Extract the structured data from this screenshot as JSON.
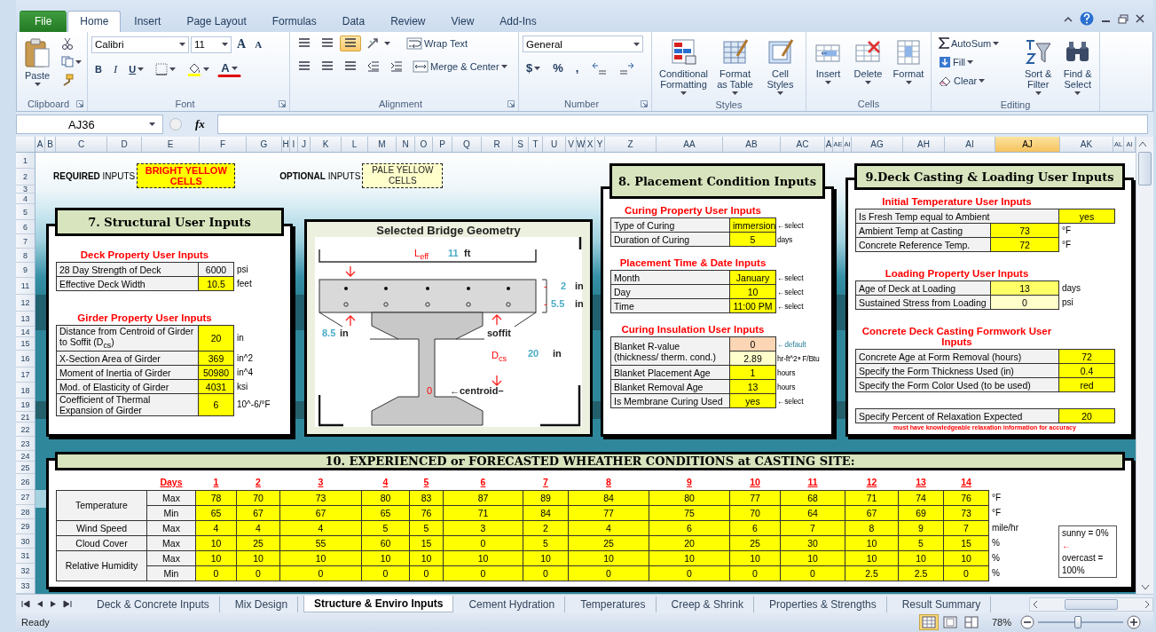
{
  "ribbon": {
    "tabs": [
      {
        "label": "File",
        "kind": "file",
        "selected": false
      },
      {
        "label": "Home",
        "kind": "tab",
        "selected": true
      },
      {
        "label": "Insert",
        "kind": "tab",
        "selected": false
      },
      {
        "label": "Page Layout",
        "kind": "tab",
        "selected": false
      },
      {
        "label": "Formulas",
        "kind": "tab",
        "selected": false
      },
      {
        "label": "Data",
        "kind": "tab",
        "selected": false
      },
      {
        "label": "Review",
        "kind": "tab",
        "selected": false
      },
      {
        "label": "View",
        "kind": "tab",
        "selected": false
      },
      {
        "label": "Add-Ins",
        "kind": "tab",
        "selected": false
      }
    ],
    "clipboard": {
      "label": "Clipboard",
      "paste": "Paste"
    },
    "font": {
      "label": "Font",
      "name": "Calibri",
      "size": "11",
      "grow": "A",
      "shrink": "A",
      "bold": "B",
      "italic": "I",
      "underline": "U",
      "color_letter": "A"
    },
    "alignment": {
      "label": "Alignment",
      "vertical": [
        {
          "selected": false
        },
        {
          "selected": false
        },
        {
          "selected": true
        }
      ],
      "wrap": "Wrap Text",
      "merge": "Merge & Center"
    },
    "number": {
      "label": "Number",
      "format": "General",
      "currency": "$",
      "percent": "%",
      "comma": ","
    },
    "styles": {
      "label": "Styles",
      "buttons": [
        "Conditional Formatting",
        "Format as Table",
        "Cell Styles"
      ]
    },
    "cells": {
      "label": "Cells",
      "buttons": [
        "Insert",
        "Delete",
        "Format"
      ]
    },
    "editing": {
      "label": "Editing",
      "small": [
        "AutoSum",
        "Fill",
        "Clear"
      ],
      "big": [
        "Sort & Filter",
        "Find & Select"
      ]
    }
  },
  "formula_bar": {
    "name_box": "AJ36",
    "function_label": "fx"
  },
  "columns": [
    {
      "label": "A",
      "selected": false
    },
    {
      "label": "B",
      "selected": false
    },
    {
      "label": "C",
      "selected": false
    },
    {
      "label": "D",
      "selected": false
    },
    {
      "label": "E",
      "selected": false
    },
    {
      "label": "F",
      "selected": false
    },
    {
      "label": "G",
      "selected": false
    },
    {
      "label": "H",
      "selected": false
    },
    {
      "label": "I",
      "selected": false
    },
    {
      "label": "J",
      "selected": false
    },
    {
      "label": "K",
      "selected": false
    },
    {
      "label": "L",
      "selected": false
    },
    {
      "label": "M",
      "selected": false
    },
    {
      "label": "N",
      "selected": false
    },
    {
      "label": "O",
      "selected": false
    },
    {
      "label": "P",
      "selected": false
    },
    {
      "label": "Q",
      "selected": false
    },
    {
      "label": "R",
      "selected": false
    },
    {
      "label": "S",
      "selected": false
    },
    {
      "label": "T",
      "selected": false
    },
    {
      "label": "U",
      "selected": false
    },
    {
      "label": "V",
      "selected": false
    },
    {
      "label": "W",
      "selected": false
    },
    {
      "label": "X",
      "selected": false
    },
    {
      "label": "Y",
      "selected": false
    },
    {
      "label": "Z",
      "selected": false
    },
    {
      "label": "AA",
      "selected": false
    },
    {
      "label": "AB",
      "selected": false
    },
    {
      "label": "AC",
      "selected": false
    },
    {
      "label": "A",
      "selected": false
    },
    {
      "label": "AE",
      "selected": false
    },
    {
      "label": "AI",
      "selected": false
    },
    {
      "label": "AG",
      "selected": false
    },
    {
      "label": "AH",
      "selected": false
    },
    {
      "label": "AI",
      "selected": false
    },
    {
      "label": "AJ",
      "selected": true
    },
    {
      "label": "AK",
      "selected": false
    },
    {
      "label": "AL",
      "selected": false
    },
    {
      "label": "AI",
      "selected": false
    }
  ],
  "rows": [
    "1",
    "2",
    "3",
    "4",
    "5",
    "6",
    "7",
    "8",
    "9",
    "11",
    "12",
    "13",
    "14",
    "15",
    "16",
    "17",
    "18",
    "19",
    "21",
    "22",
    "23",
    "24",
    "25",
    "26",
    "27",
    "28",
    "29",
    "30",
    "31",
    "32",
    "33"
  ],
  "legend": {
    "required_label": "**REQUIRED** INPUTS",
    "required_box": "BRIGHT YELLOW CELLS",
    "optional_label": "**OPTIONAL** INPUTS",
    "optional_box": "PALE YELLOW CELLS"
  },
  "structural": {
    "title": "7. Structural User Inputs",
    "sections": [
      {
        "heading": "Deck Property User Inputs",
        "rows": [
          {
            "label": "28 Day Strength of Deck",
            "value": "6000",
            "kind": "calculated",
            "unit": "psi"
          },
          {
            "label": "Effective Deck Width",
            "value": "10.5",
            "kind": "required",
            "unit": "feet"
          }
        ]
      },
      {
        "heading": "Girder Property User Inputs",
        "rows": [
          {
            "label": "Distance from Centroid of Girder to Soffit (D$_{cs}$)",
            "value": "20",
            "kind": "required",
            "unit": "in"
          },
          {
            "label": "X-Section Area of Girder",
            "value": "369",
            "kind": "required",
            "unit": "in^2"
          },
          {
            "label": "Moment of Inertia of Girder",
            "value": "50980",
            "kind": "required",
            "unit": "in^4"
          },
          {
            "label": "Mod. of Elasticity of Girder",
            "value": "4031",
            "kind": "required",
            "unit": "ksi"
          },
          {
            "label": "Coefficient of Thermal Expansion of Girder",
            "value": "6",
            "kind": "required",
            "unit": "10^-6/°F"
          }
        ]
      }
    ]
  },
  "geometry": {
    "title": "Selected Bridge Geometry",
    "span_symbol": "L$_{eff}$",
    "span_value": "11",
    "span_unit": "ft",
    "top_marker": "-",
    "top_cover": "2",
    "top_cover_unit": "in",
    "bottom_marker": "-",
    "bottom_cover": "5.5",
    "bottom_cover_unit": "in",
    "haunch": "8.5",
    "haunch_unit": "in",
    "soffit": "soffit",
    "dcs_symbol": "D$_{cs}$",
    "dcs_value": "20",
    "dcs_unit": "in",
    "centroid_mark": "0",
    "centroid_label": "←centroid–"
  },
  "placement": {
    "title": "8. Placement Condition Inputs",
    "sections": [
      {
        "heading": "Curing Property User Inputs",
        "rows": [
          {
            "label": "Type of Curing",
            "value": "immersion",
            "kind": "required",
            "unit": "←select"
          },
          {
            "label": "Duration of Curing",
            "value": "5",
            "kind": "required",
            "unit": "days"
          }
        ]
      },
      {
        "heading": "Placement Time & Date Inputs",
        "rows": [
          {
            "label": "Month",
            "value": "January",
            "kind": "required",
            "unit": "←select"
          },
          {
            "label": "Day",
            "value": "10",
            "kind": "required",
            "unit": "←select"
          },
          {
            "label": "Time",
            "value": "11:00 PM",
            "kind": "required",
            "unit": "←select"
          }
        ]
      },
      {
        "heading": "Curing Insulation User Inputs",
        "rows": [
          {
            "label": "Blanket R-value (thickness/ therm. cond.)",
            "values": [
              {
                "value": "0",
                "kind": "default",
                "unit": "←default"
              },
              {
                "value": "2.89",
                "kind": "optional",
                "unit": "hr-ft^2∘F/Btu"
              }
            ]
          },
          {
            "label": "Blanket Placement Age",
            "value": "1",
            "kind": "required",
            "unit": "hours"
          },
          {
            "label": "Blanket Removal Age",
            "value": "13",
            "kind": "required",
            "unit": "hours"
          },
          {
            "label": "Is Membrane Curing Used",
            "value": "yes",
            "kind": "required",
            "unit": "←select"
          }
        ]
      }
    ]
  },
  "casting": {
    "title": "9.Deck Casting & Loading User Inputs",
    "sections": [
      {
        "heading": "Initial Temperature User Inputs",
        "rows": [
          {
            "label": "Is Fresh Temp equal to Ambient",
            "value": "yes",
            "kind": "required"
          },
          {
            "label": "Ambient Temp at Casting",
            "value": "73",
            "kind": "required",
            "unit": "°F"
          },
          {
            "label": "Concrete Reference Temp.",
            "value": "72",
            "kind": "required",
            "unit": "°F"
          }
        ]
      },
      {
        "heading": "Loading Property User Inputs",
        "rows": [
          {
            "label": "Age of Deck at Loading",
            "value": "13",
            "kind": "light",
            "unit": "days"
          },
          {
            "label": "Sustained Stress from Loading",
            "value": "0",
            "kind": "optional",
            "unit": "psi"
          }
        ]
      },
      {
        "heading": "Concrete Deck Casting Formwork User Inputs",
        "rows": [
          {
            "label": "Concrete Age at Form Removal (hours)",
            "value": "72",
            "kind": "required"
          },
          {
            "label": "Specify the Form Thickness Used (in)",
            "value": "0.4",
            "kind": "required"
          },
          {
            "label": "Specify the Form Color Used (to be used)",
            "value": "red",
            "kind": "required"
          }
        ]
      },
      {
        "rows": [
          {
            "label": "Specify Percent of Relaxation Expected",
            "value": "20",
            "kind": "required"
          }
        ],
        "footnote": "must have knowledgeable relaxation information for accuracy"
      }
    ]
  },
  "weather": {
    "title": "10. EXPERIENCED or FORECASTED WHEATHER CONDITIONS at CASTING SITE:",
    "days_label": "Days",
    "days": [
      "1",
      "2",
      "3",
      "4",
      "5",
      "6",
      "7",
      "8",
      "9",
      "10",
      "11",
      "12",
      "13",
      "14"
    ],
    "groups": [
      {
        "label": "Temperature",
        "rows": [
          {
            "sub": "Max",
            "values": [
              "78",
              "70",
              "73",
              "80",
              "83",
              "87",
              "89",
              "84",
              "80",
              "77",
              "68",
              "71",
              "74",
              "76"
            ],
            "unit": "°F"
          },
          {
            "sub": "Min",
            "values": [
              "65",
              "67",
              "67",
              "65",
              "76",
              "71",
              "84",
              "77",
              "75",
              "70",
              "64",
              "67",
              "69",
              "73"
            ],
            "unit": "°F"
          }
        ]
      },
      {
        "label": "Wind Speed",
        "rows": [
          {
            "sub": "Max",
            "values": [
              "4",
              "4",
              "4",
              "5",
              "5",
              "3",
              "2",
              "4",
              "6",
              "6",
              "7",
              "8",
              "9",
              "7"
            ],
            "unit": "mile/hr"
          }
        ]
      },
      {
        "label": "Cloud Cover",
        "rows": [
          {
            "sub": "Max",
            "values": [
              "10",
              "25",
              "55",
              "60",
              "15",
              "0",
              "5",
              "25",
              "20",
              "25",
              "30",
              "10",
              "5",
              "15"
            ],
            "unit": "%"
          }
        ]
      },
      {
        "label": "Relative Humidity",
        "rows": [
          {
            "sub": "Max",
            "values": [
              "10",
              "10",
              "10",
              "10",
              "10",
              "10",
              "10",
              "10",
              "10",
              "10",
              "10",
              "10",
              "10",
              "10"
            ],
            "unit": "%"
          },
          {
            "sub": "Min",
            "values": [
              "0",
              "0",
              "0",
              "0",
              "0",
              "0",
              "0",
              "0",
              "0",
              "0",
              "0",
              "2.5",
              "2.5",
              "0"
            ],
            "unit": "%"
          }
        ]
      }
    ],
    "note": [
      {
        "kind": "text",
        "text": "sunny = 0%"
      },
      {
        "kind": "arrow",
        "text": "←"
      },
      {
        "kind": "text",
        "text": "overcast ="
      },
      {
        "kind": "text",
        "text": "100%"
      }
    ]
  },
  "sheet_tabs": [
    {
      "label": "Deck & Concrete Inputs",
      "selected": false
    },
    {
      "label": "Mix Design",
      "selected": false
    },
    {
      "label": "Structure & Enviro Inputs",
      "selected": true
    },
    {
      "label": "Cement Hydration",
      "selected": false
    },
    {
      "label": "Temperatures",
      "selected": false
    },
    {
      "label": "Creep & Shrink",
      "selected": false
    },
    {
      "label": "Properties & Strengths",
      "selected": false
    },
    {
      "label": "Result Summary",
      "selected": false
    }
  ],
  "status_bar": {
    "text": "Ready",
    "views": [
      {
        "selected": true
      },
      {
        "selected": false
      },
      {
        "selected": false
      }
    ],
    "zoom": "78%",
    "zoom_slider": {
      "level": 0.47
    }
  }
}
